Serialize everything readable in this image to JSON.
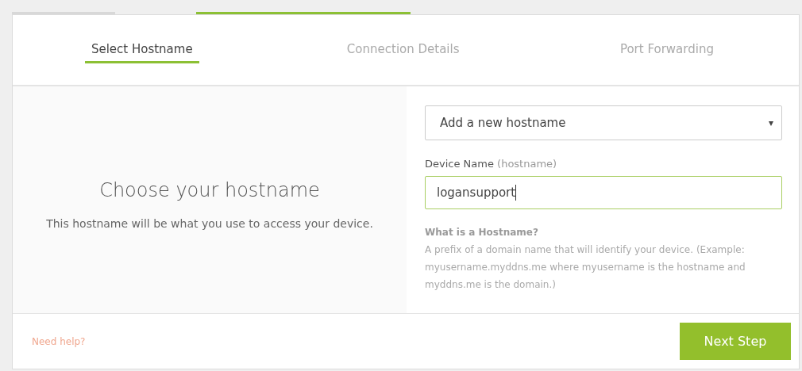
{
  "tabs": [
    {
      "label": "Select Hostname",
      "selected": true
    },
    {
      "label": "Connection Details",
      "selected": false
    },
    {
      "label": "Port Forwarding",
      "selected": false
    }
  ],
  "intro": {
    "heading": "Choose your hostname",
    "text": "This hostname will be what you use to access your device."
  },
  "hostname_select": {
    "value": "Add a new hostname",
    "arrow": "▾"
  },
  "device_name": {
    "label": "Device Name",
    "hint": "(hostname)",
    "value": "logansupport",
    "focused": true
  },
  "info": {
    "title": "What is a Hostname?",
    "text": "A prefix of a domain name that will identify your device. (Example: myusername.myddns.me where myusername is the hostname and myddns.me is the domain.)"
  },
  "footer": {
    "help_link": "Need help?",
    "next_button": "Next Step"
  }
}
